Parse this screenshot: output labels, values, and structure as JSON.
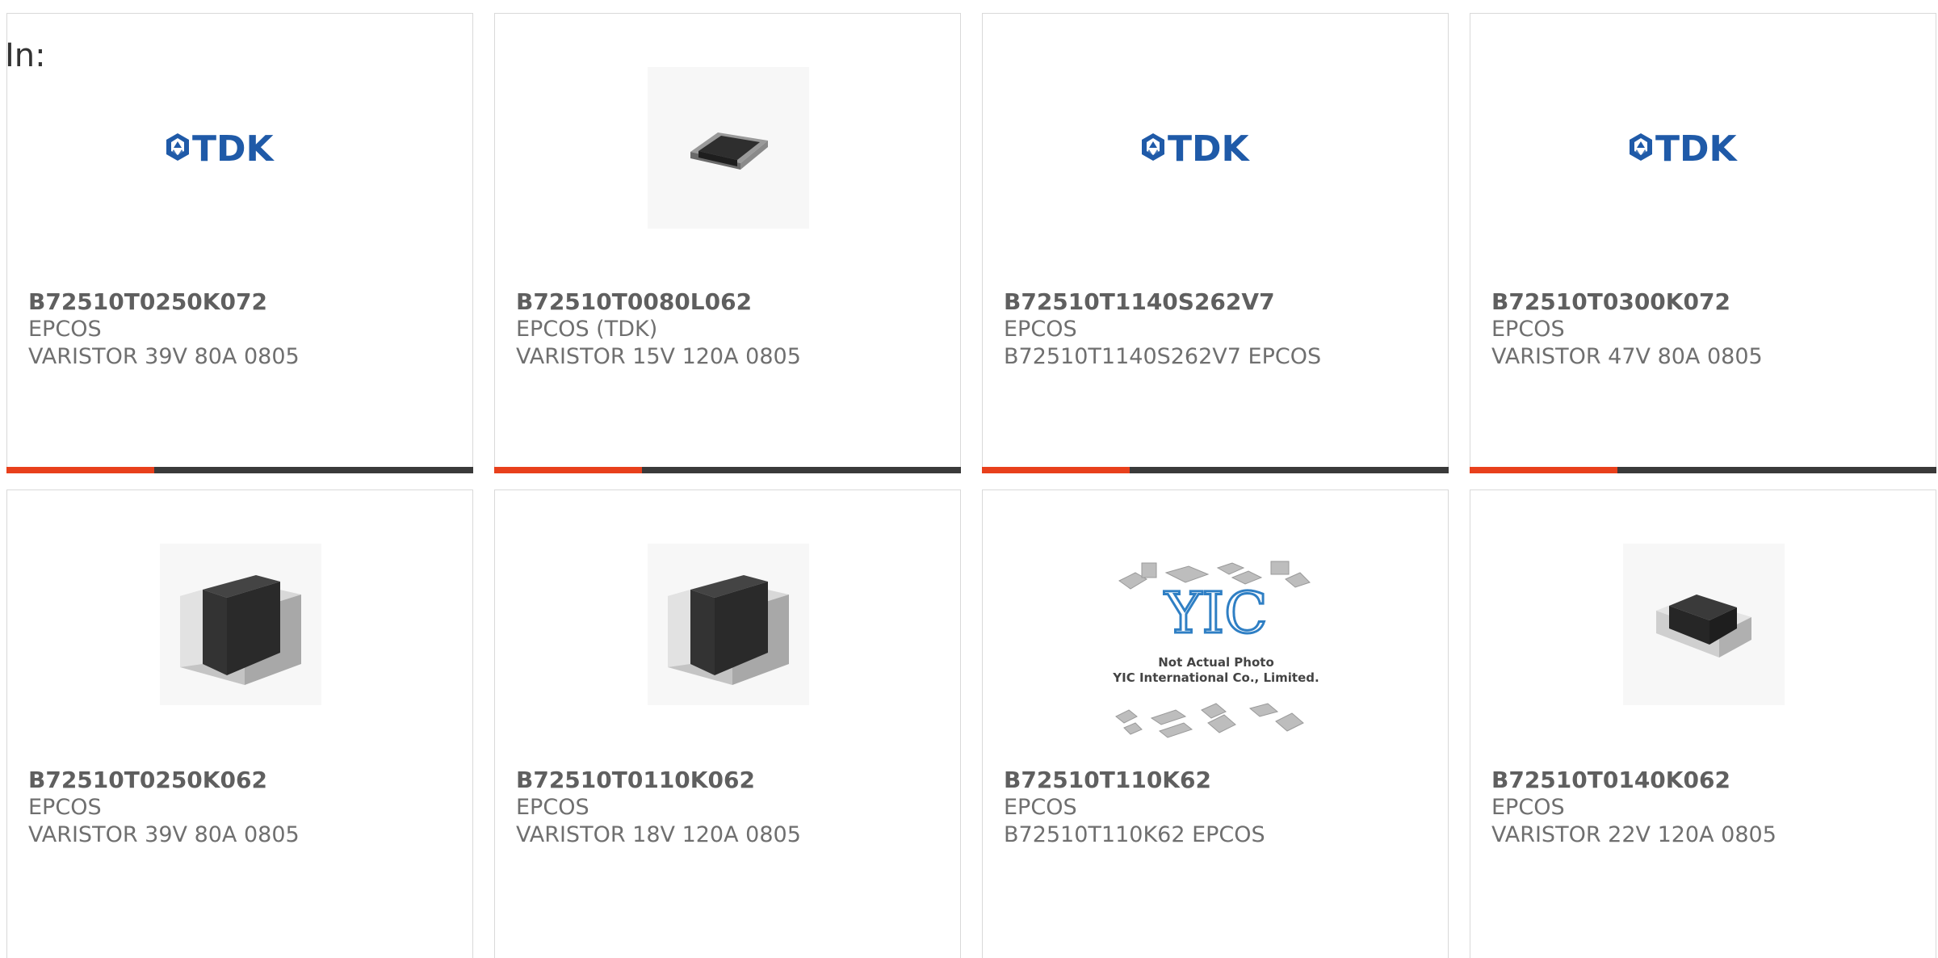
{
  "header": {
    "in_label": "In:"
  },
  "colors": {
    "accent": "#e8401c",
    "bar": "#3a3a3a",
    "tdk_blue": "#1f5aa8"
  },
  "products": [
    {
      "part_number": "B72510T0250K072",
      "manufacturer": "EPCOS",
      "description": "VARISTOR 39V 80A 0805",
      "image": "tdk-logo",
      "logo_text": "TDK"
    },
    {
      "part_number": "B72510T0080L062",
      "manufacturer": "EPCOS (TDK)",
      "description": "VARISTOR 15V 120A 0805",
      "image": "smd-chip-small"
    },
    {
      "part_number": "B72510T1140S262V7",
      "manufacturer": "EPCOS",
      "description": "B72510T1140S262V7 EPCOS",
      "image": "tdk-logo",
      "logo_text": "TDK"
    },
    {
      "part_number": "B72510T0300K072",
      "manufacturer": "EPCOS",
      "description": "VARISTOR 47V 80A 0805",
      "image": "tdk-logo",
      "logo_text": "TDK"
    },
    {
      "part_number": "B72510T0250K062",
      "manufacturer": "EPCOS",
      "description": "VARISTOR 39V 80A 0805",
      "image": "smd-chip-large"
    },
    {
      "part_number": "B72510T0110K062",
      "manufacturer": "EPCOS",
      "description": "VARISTOR 18V 120A 0805",
      "image": "smd-chip-large"
    },
    {
      "part_number": "B72510T110K62",
      "manufacturer": "EPCOS",
      "description": "B72510T110K62 EPCOS",
      "image": "yic-placeholder",
      "logo_text": "YIC",
      "placeholder_line1": "Not Actual Photo",
      "placeholder_line2": "YIC International Co., Limited."
    },
    {
      "part_number": "B72510T0140K062",
      "manufacturer": "EPCOS",
      "description": "VARISTOR 22V 120A 0805",
      "image": "smd-chip-angled"
    }
  ]
}
